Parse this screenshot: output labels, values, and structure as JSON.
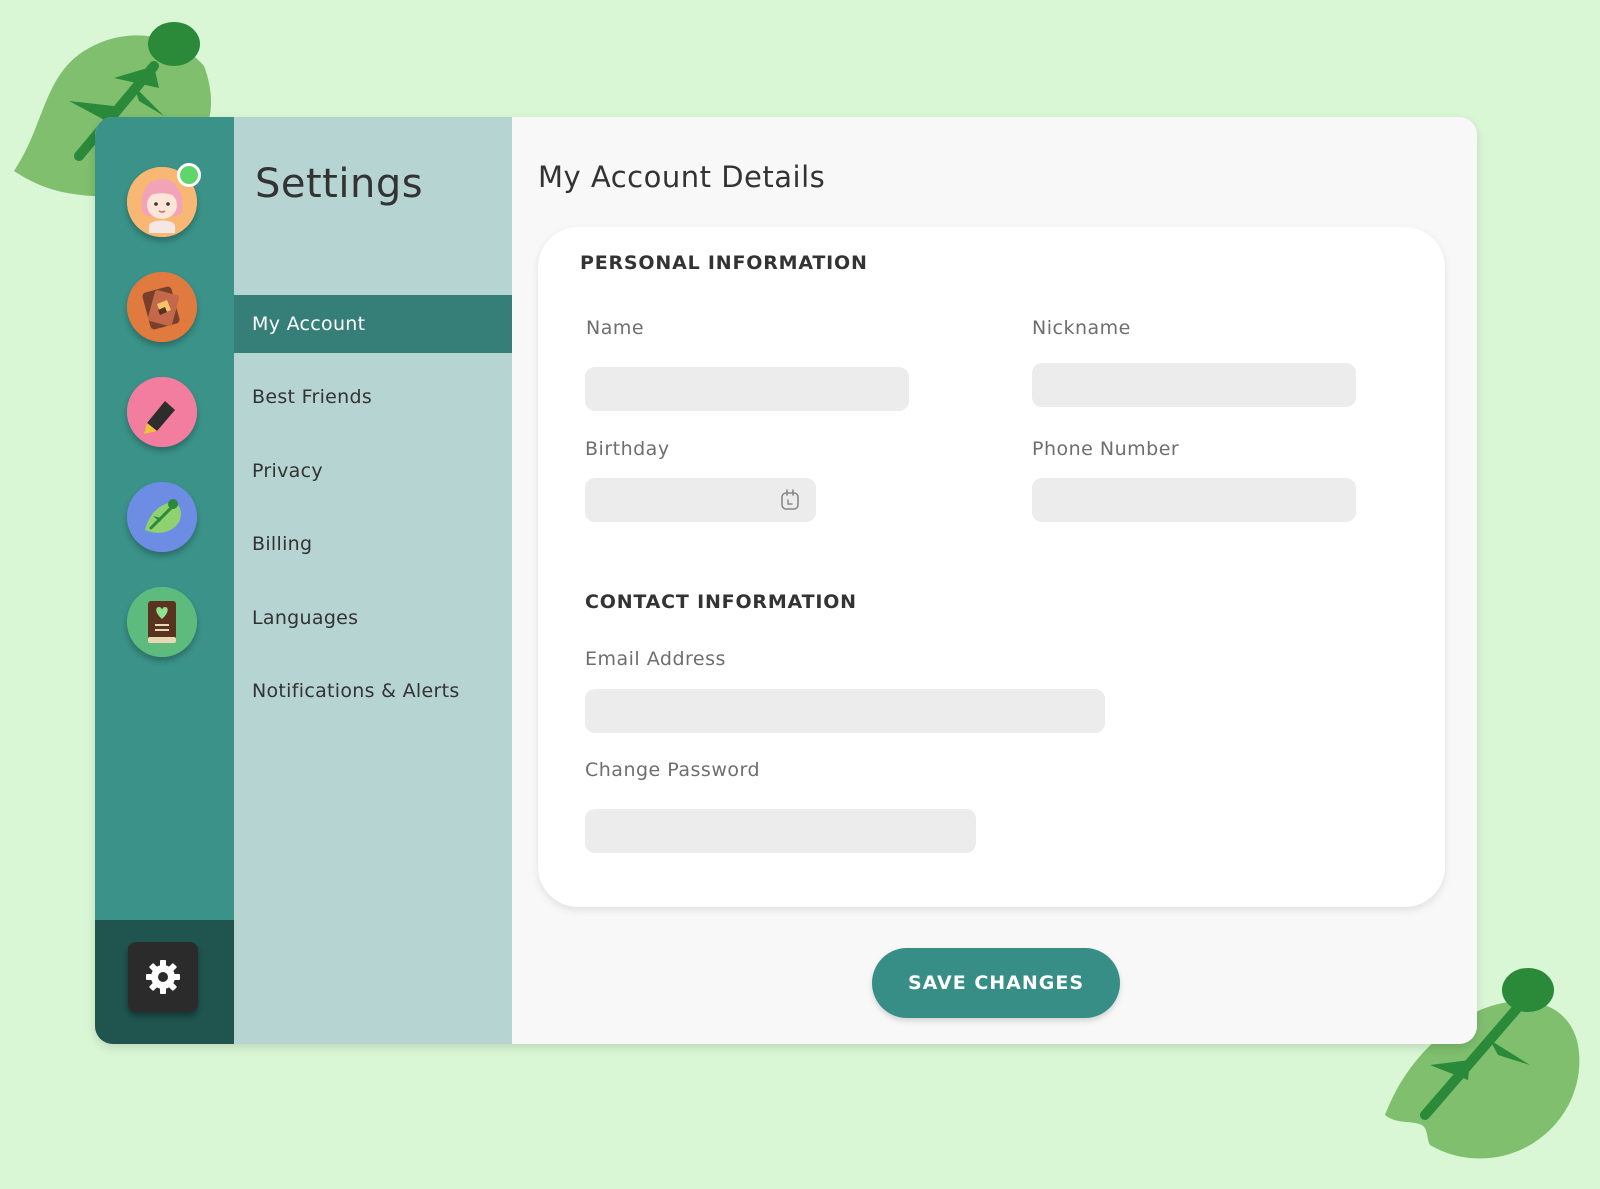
{
  "sidebar": {
    "rail_icons": [
      {
        "name": "profile-avatar",
        "bg": "#f8b773"
      },
      {
        "name": "passport-icon",
        "bg": "#e07a3f"
      },
      {
        "name": "pencil-icon",
        "bg": "#f27d9e"
      },
      {
        "name": "leaf-icon",
        "bg": "#6d8ce3"
      },
      {
        "name": "journal-icon",
        "bg": "#5dbb7e"
      }
    ],
    "settings_icon": "gear-icon"
  },
  "menu": {
    "title": "Settings",
    "items": [
      {
        "label": "My Account",
        "active": true
      },
      {
        "label": "Best Friends",
        "active": false
      },
      {
        "label": "Privacy",
        "active": false
      },
      {
        "label": "Billing",
        "active": false
      },
      {
        "label": "Languages",
        "active": false
      },
      {
        "label": "Notifications & Alerts",
        "active": false
      }
    ]
  },
  "main": {
    "title": "My Account Details",
    "personal": {
      "title": "PERSONAL INFORMATION",
      "name_label": "Name",
      "name_value": "",
      "nickname_label": "Nickname",
      "nickname_value": "",
      "birthday_label": "Birthday",
      "birthday_value": "",
      "phone_label": "Phone Number",
      "phone_value": ""
    },
    "contact": {
      "title": "CONTACT INFORMATION",
      "email_label": "Email Address",
      "email_value": "",
      "password_label": "Change Password",
      "password_value": ""
    },
    "save_label": "SAVE CHANGES"
  },
  "colors": {
    "background": "#d9f7d4",
    "rail": "#3a9288",
    "rail_bottom": "#1f544f",
    "menu": "#b5d4d2",
    "menu_active": "#367f78",
    "accent": "#378e86",
    "leaf": "#7fbf6e",
    "leaf_dark": "#2a8a3a",
    "online": "#5fd56b"
  }
}
